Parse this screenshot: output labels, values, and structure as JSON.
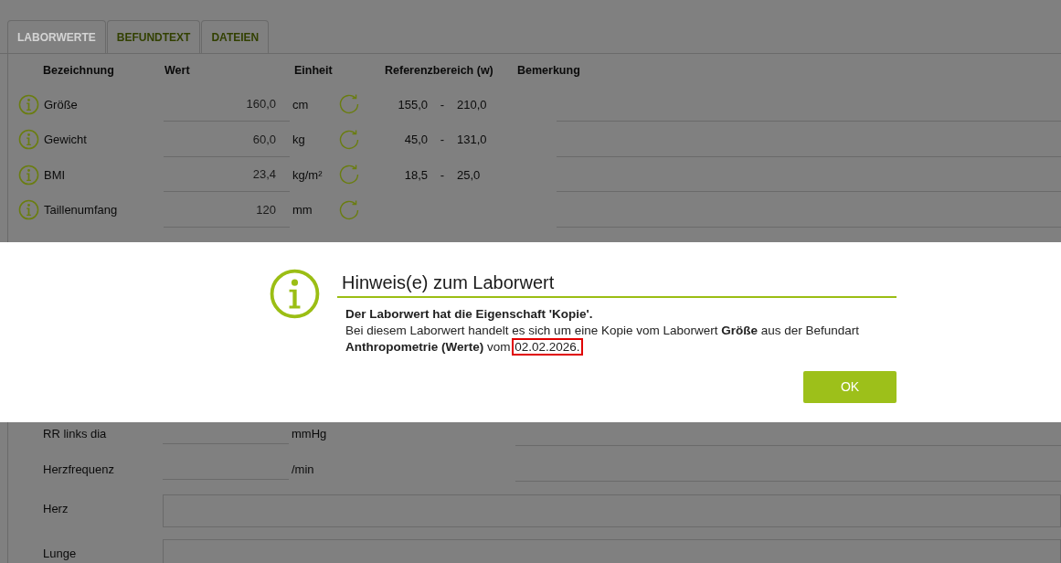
{
  "tabs": [
    {
      "label": "LABORWERTE",
      "selected": true
    },
    {
      "label": "BEFUNDTEXT",
      "selected": false
    },
    {
      "label": "DATEIEN",
      "selected": false
    }
  ],
  "table": {
    "columns": [
      "Bezeichnung",
      "Wert",
      "Einheit",
      "Referenzbereich (w)",
      "Bemerkung"
    ],
    "rows": [
      {
        "name": "Größe",
        "value": "160,0",
        "unit": "cm",
        "ref_low": "155,0",
        "ref_sep": "-",
        "ref_high": "210,0"
      },
      {
        "name": "Gewicht",
        "value": "60,0",
        "unit": "kg",
        "ref_low": "45,0",
        "ref_sep": "-",
        "ref_high": "131,0"
      },
      {
        "name": "BMI",
        "value": "23,4",
        "unit": "kg/m²",
        "ref_low": "18,5",
        "ref_sep": "-",
        "ref_high": "25,0"
      },
      {
        "name": "Taillenumfang",
        "value": "120",
        "unit": "mm"
      }
    ]
  },
  "lower_rows": [
    {
      "kind": "field",
      "name": "RR links dia",
      "unit": "mmHg"
    },
    {
      "kind": "field",
      "name": "Herzfrequenz",
      "unit": "/min"
    },
    {
      "kind": "textarea",
      "name": "Herz"
    },
    {
      "kind": "textarea",
      "name": "Lunge"
    }
  ],
  "dialog": {
    "title": "Hinweis(e) zum Laborwert",
    "heading": "Der Laborwert hat die Eigenschaft 'Kopie'.",
    "text": "Bei diesem Laborwert handelt es sich um eine Kopie vom Laborwert **Größe** aus der Befundart **Anthropometrie (Werte)** vom",
    "date": "02.02.2026.",
    "date_highlighted": true,
    "button": "OK"
  }
}
